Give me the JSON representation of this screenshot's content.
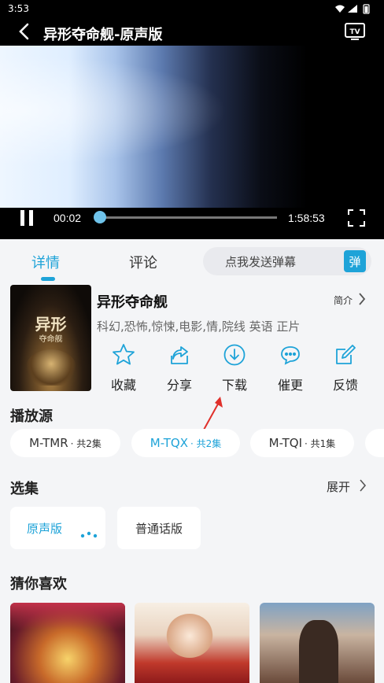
{
  "status_bar": {
    "time": "3:53"
  },
  "header": {
    "title": "异形夺命舰-原声版"
  },
  "player": {
    "current_time": "00:02",
    "duration": "1:58:53",
    "progress": 0.02
  },
  "tabs": [
    {
      "label": "详情"
    },
    {
      "label": "评论"
    }
  ],
  "danmu": {
    "placeholder": "点我发送弹幕",
    "button": "弹"
  },
  "movie": {
    "title": "异形夺命舰",
    "intro_label": "简介",
    "meta": "科幻,恐怖,惊悚,电影,情,院线 英语 正片",
    "poster_title": "异形",
    "poster_subtitle": "夺命舰"
  },
  "actions": [
    {
      "label": "收藏",
      "icon": "star-icon"
    },
    {
      "label": "分享",
      "icon": "share-icon"
    },
    {
      "label": "下载",
      "icon": "download-icon"
    },
    {
      "label": "催更",
      "icon": "urge-icon"
    },
    {
      "label": "反馈",
      "icon": "feedback-icon"
    }
  ],
  "sources": {
    "title": "播放源",
    "items": [
      {
        "name": "M-TMR",
        "count": "· 共2集"
      },
      {
        "name": "M-TQX",
        "count": "· 共2集"
      },
      {
        "name": "M-TQI",
        "count": "· 共1集"
      }
    ]
  },
  "episodes": {
    "title": "选集",
    "expand_label": "展开",
    "items": [
      {
        "label": "原声版"
      },
      {
        "label": "普通话版"
      }
    ]
  },
  "recommend": {
    "title": "猜你喜欢"
  },
  "colors": {
    "accent": "#1ea3d8",
    "arrow": "#e0302b"
  }
}
